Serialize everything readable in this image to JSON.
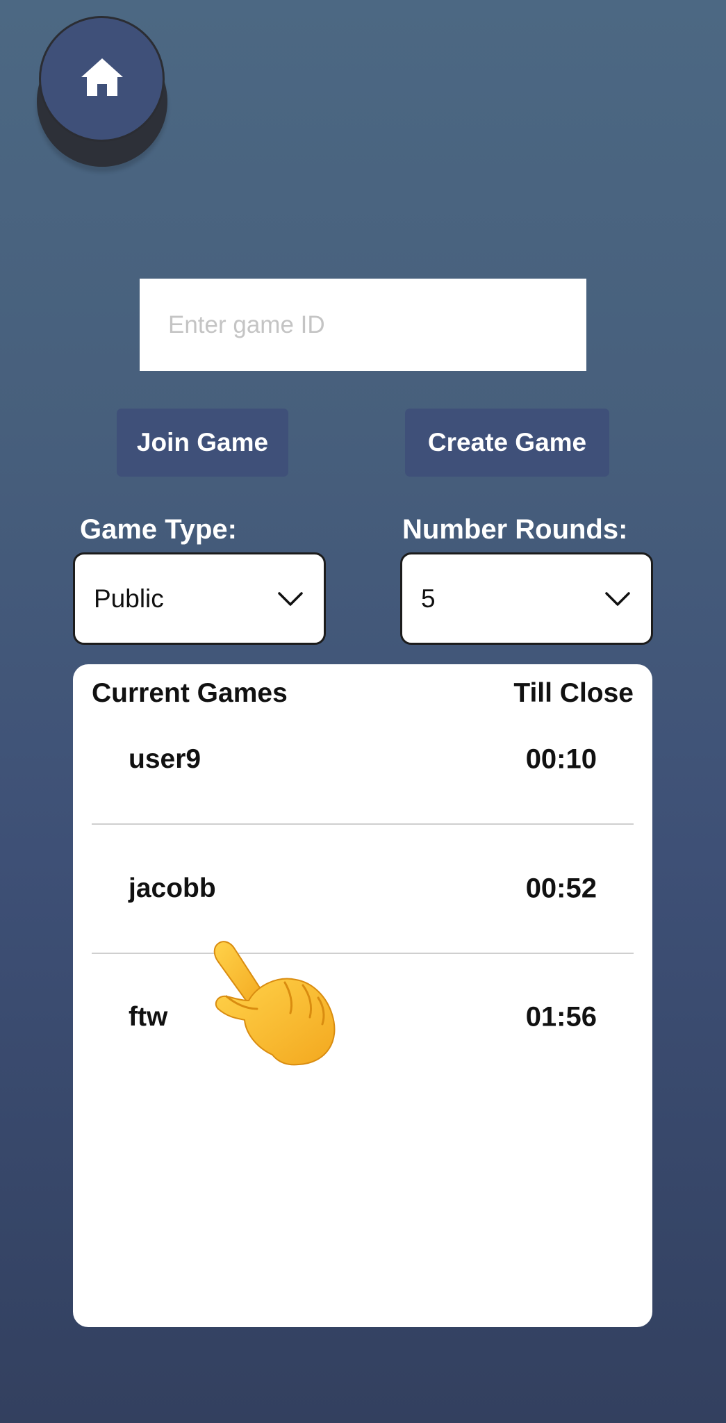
{
  "home": {
    "icon": "home-icon"
  },
  "game_id_input": {
    "value": "",
    "placeholder": "Enter game ID"
  },
  "buttons": {
    "join": "Join Game",
    "create": "Create Game"
  },
  "game_type": {
    "label": "Game Type:",
    "selected": "Public"
  },
  "number_rounds": {
    "label": "Number Rounds:",
    "selected": "5"
  },
  "games": {
    "header_left": "Current Games",
    "header_right": "Till Close",
    "rows": [
      {
        "name": "user9",
        "time": "00:10"
      },
      {
        "name": "jacobb",
        "time": "00:52"
      },
      {
        "name": "ftw",
        "time": "01:56"
      }
    ]
  },
  "overlay": {
    "icon": "pointing-hand-icon"
  },
  "colors": {
    "button_blue": "#3f5079",
    "card_white": "#ffffff"
  }
}
